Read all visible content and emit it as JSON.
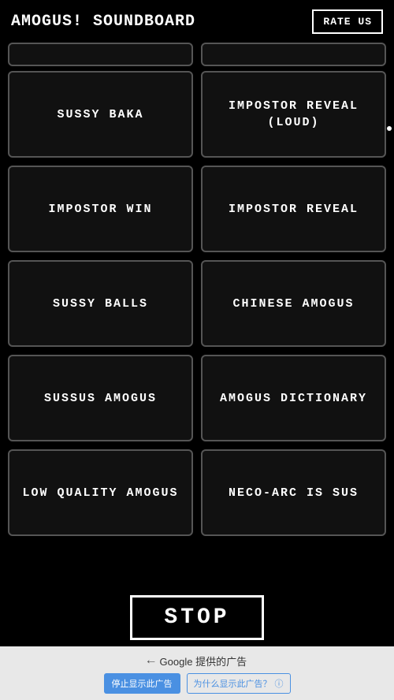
{
  "header": {
    "title": "AMOGUS! Soundboard",
    "rate_us_label": "RATE US"
  },
  "stop_button": {
    "label": "STOP"
  },
  "sounds": [
    {
      "id": "sussy-baka",
      "label": "SUSSY BAKA"
    },
    {
      "id": "impostor-reveal-loud",
      "label": "IMPOSTOR REVEAL (LOUD)"
    },
    {
      "id": "impostor-win",
      "label": "IMPOSTOR WIN"
    },
    {
      "id": "impostor-reveal",
      "label": "IMPOSTOR REVEAL"
    },
    {
      "id": "sussy-balls",
      "label": "SUSSY BALLS"
    },
    {
      "id": "chinese-amogus",
      "label": "CHINESE AMOGUS"
    },
    {
      "id": "sussus-amogus",
      "label": "SUSSUS AMOGUS"
    },
    {
      "id": "amogus-dictionary",
      "label": "AMOGUS DICTIONARY"
    },
    {
      "id": "low-quality-amogus",
      "label": "LOW QUALITY AMOGUS"
    },
    {
      "id": "neco-arc-is-sus",
      "label": "NECO-ARC IS SUS"
    }
  ],
  "ad": {
    "google_text": "Google 提供的广告",
    "stop_ad_label": "停止显示此广告",
    "why_label": "为什么显示此广告？",
    "info_icon": "ⓘ"
  }
}
